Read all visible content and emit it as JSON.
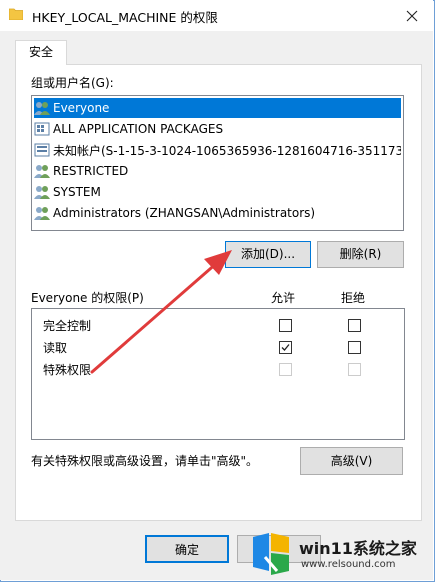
{
  "window": {
    "title": "HKEY_LOCAL_MACHINE 的权限"
  },
  "tabs": [
    {
      "label": "安全"
    }
  ],
  "groups": {
    "label": "组或用户名(G):",
    "items": [
      {
        "name": "Everyone",
        "icon": "users-icon",
        "selected": true
      },
      {
        "name": "ALL APPLICATION PACKAGES",
        "icon": "app-packages-icon",
        "selected": false
      },
      {
        "name": "未知帐户(S-1-15-3-1024-1065365936-1281604716-351173...",
        "icon": "unknown-account-icon",
        "selected": false
      },
      {
        "name": "RESTRICTED",
        "icon": "users-icon",
        "selected": false
      },
      {
        "name": "SYSTEM",
        "icon": "users-icon",
        "selected": false
      },
      {
        "name": "Administrators (ZHANGSAN\\Administrators)",
        "icon": "users-icon",
        "selected": false
      }
    ]
  },
  "buttons": {
    "add": "添加(D)...",
    "remove": "删除(R)",
    "advanced": "高级(V)",
    "ok": "确定"
  },
  "permissions": {
    "label": "Everyone 的权限(P)",
    "allow_header": "允许",
    "deny_header": "拒绝",
    "rows": [
      {
        "name": "完全控制",
        "allow": false,
        "deny": false,
        "enabled": true
      },
      {
        "name": "读取",
        "allow": true,
        "deny": false,
        "enabled": true
      },
      {
        "name": "特殊权限",
        "allow": false,
        "deny": false,
        "enabled": false
      }
    ]
  },
  "advanced_hint": "有关特殊权限或高级设置，请单击\"高级\"。",
  "watermark": {
    "brand": "win11系统之家",
    "url": "www.relsound.com"
  },
  "colors": {
    "accent": "#0078d7",
    "annotation": "#e03b3b"
  }
}
